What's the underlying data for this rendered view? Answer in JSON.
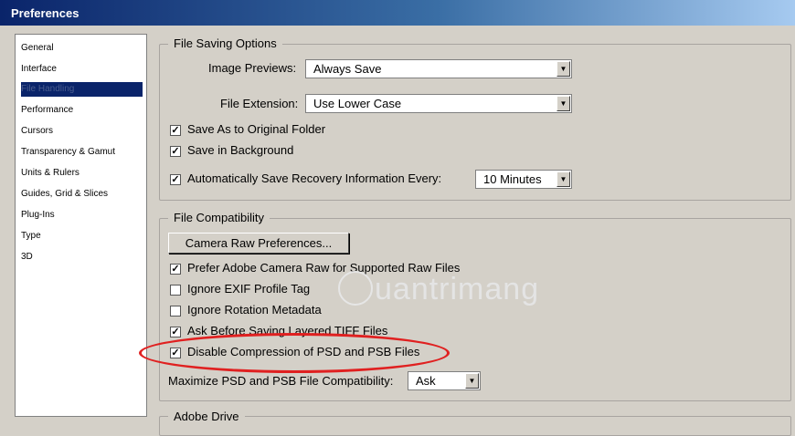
{
  "window": {
    "title": "Preferences"
  },
  "sidebar": {
    "items": [
      "General",
      "Interface",
      "File Handling",
      "Performance",
      "Cursors",
      "Transparency & Gamut",
      "Units & Rulers",
      "Guides, Grid & Slices",
      "Plug-Ins",
      "Type",
      "3D"
    ],
    "selected": "File Handling"
  },
  "file_saving": {
    "title": "File Saving Options",
    "image_previews_label": "Image Previews:",
    "image_previews_value": "Always Save",
    "file_extension_label": "File Extension:",
    "file_extension_value": "Use Lower Case",
    "save_as_original": {
      "label": "Save As to Original Folder",
      "checked": true
    },
    "save_background": {
      "label": "Save in Background",
      "checked": true
    },
    "auto_save": {
      "label": "Automatically Save Recovery Information Every:",
      "checked": true
    },
    "auto_save_value": "10 Minutes"
  },
  "file_compat": {
    "title": "File Compatibility",
    "camera_raw_button": "Camera Raw Preferences...",
    "prefer_acr": {
      "label": "Prefer Adobe Camera Raw for Supported Raw Files",
      "checked": true
    },
    "ignore_exif": {
      "label": "Ignore EXIF Profile Tag",
      "checked": false
    },
    "ignore_rotation": {
      "label": "Ignore Rotation Metadata",
      "checked": false
    },
    "ask_tiff": {
      "label": "Ask Before Saving Layered TIFF Files",
      "checked": true
    },
    "disable_compression": {
      "label": "Disable Compression of PSD and PSB Files",
      "checked": true
    },
    "maximize_label": "Maximize PSD and PSB File Compatibility:",
    "maximize_value": "Ask"
  },
  "adobe_drive": {
    "title": "Adobe Drive"
  },
  "watermark": "uantrimang",
  "colors": {
    "highlight": "#e02020",
    "selection": "#0a246a"
  }
}
